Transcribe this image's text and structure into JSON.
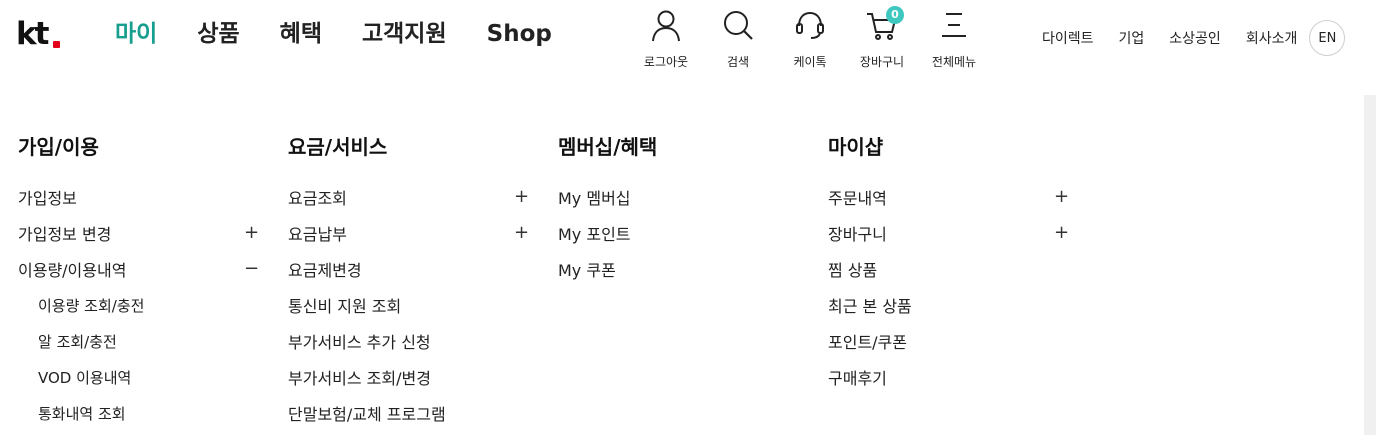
{
  "logo": {
    "text": "kt"
  },
  "gnb": [
    {
      "label": "마이",
      "active": true
    },
    {
      "label": "상품",
      "active": false
    },
    {
      "label": "혜택",
      "active": false
    },
    {
      "label": "고객지원",
      "active": false
    },
    {
      "label": "Shop",
      "active": false
    }
  ],
  "utils": {
    "logout": {
      "label": "로그아웃",
      "icon": "person-icon"
    },
    "search": {
      "label": "검색",
      "icon": "search-icon"
    },
    "ktalk": {
      "label": "케이톡",
      "icon": "headset-icon"
    },
    "cart": {
      "label": "장바구니",
      "icon": "cart-icon",
      "count": "0"
    },
    "allmenu": {
      "label": "전체메뉴",
      "icon": "menu-icon"
    }
  },
  "top_links": [
    "다이렉트",
    "기업",
    "소상공인",
    "회사소개"
  ],
  "lang": "EN",
  "colors": {
    "accent": "#179e8e",
    "badge": "#3ec8c0",
    "brand_red": "#e2001a"
  },
  "columns": [
    {
      "title": "가입/이용",
      "items": [
        {
          "label": "가입정보",
          "toggle": ""
        },
        {
          "label": "가입정보 변경",
          "toggle": "+"
        },
        {
          "label": "이용량/이용내역",
          "toggle": "−"
        },
        {
          "label": "이용량 조회/충전",
          "toggle": "",
          "sub": true
        },
        {
          "label": "알 조회/충전",
          "toggle": "",
          "sub": true
        },
        {
          "label": "VOD 이용내역",
          "toggle": "",
          "sub": true
        },
        {
          "label": "통화내역 조회",
          "toggle": "",
          "sub": true
        }
      ]
    },
    {
      "title": "요금/서비스",
      "items": [
        {
          "label": "요금조회",
          "toggle": "+"
        },
        {
          "label": "요금납부",
          "toggle": "+"
        },
        {
          "label": "요금제변경",
          "toggle": ""
        },
        {
          "label": "통신비 지원 조회",
          "toggle": ""
        },
        {
          "label": "부가서비스 추가 신청",
          "toggle": ""
        },
        {
          "label": "부가서비스 조회/변경",
          "toggle": ""
        },
        {
          "label": "단말보험/교체 프로그램",
          "toggle": ""
        }
      ]
    },
    {
      "title": "멤버십/혜택",
      "items": [
        {
          "label": "My 멤버십",
          "toggle": ""
        },
        {
          "label": "My 포인트",
          "toggle": ""
        },
        {
          "label": "My 쿠폰",
          "toggle": ""
        }
      ]
    },
    {
      "title": "마이샵",
      "items": [
        {
          "label": "주문내역",
          "toggle": "+"
        },
        {
          "label": "장바구니",
          "toggle": "+"
        },
        {
          "label": "찜 상품",
          "toggle": ""
        },
        {
          "label": "최근 본 상품",
          "toggle": ""
        },
        {
          "label": "포인트/쿠폰",
          "toggle": ""
        },
        {
          "label": "구매후기",
          "toggle": ""
        }
      ]
    }
  ]
}
